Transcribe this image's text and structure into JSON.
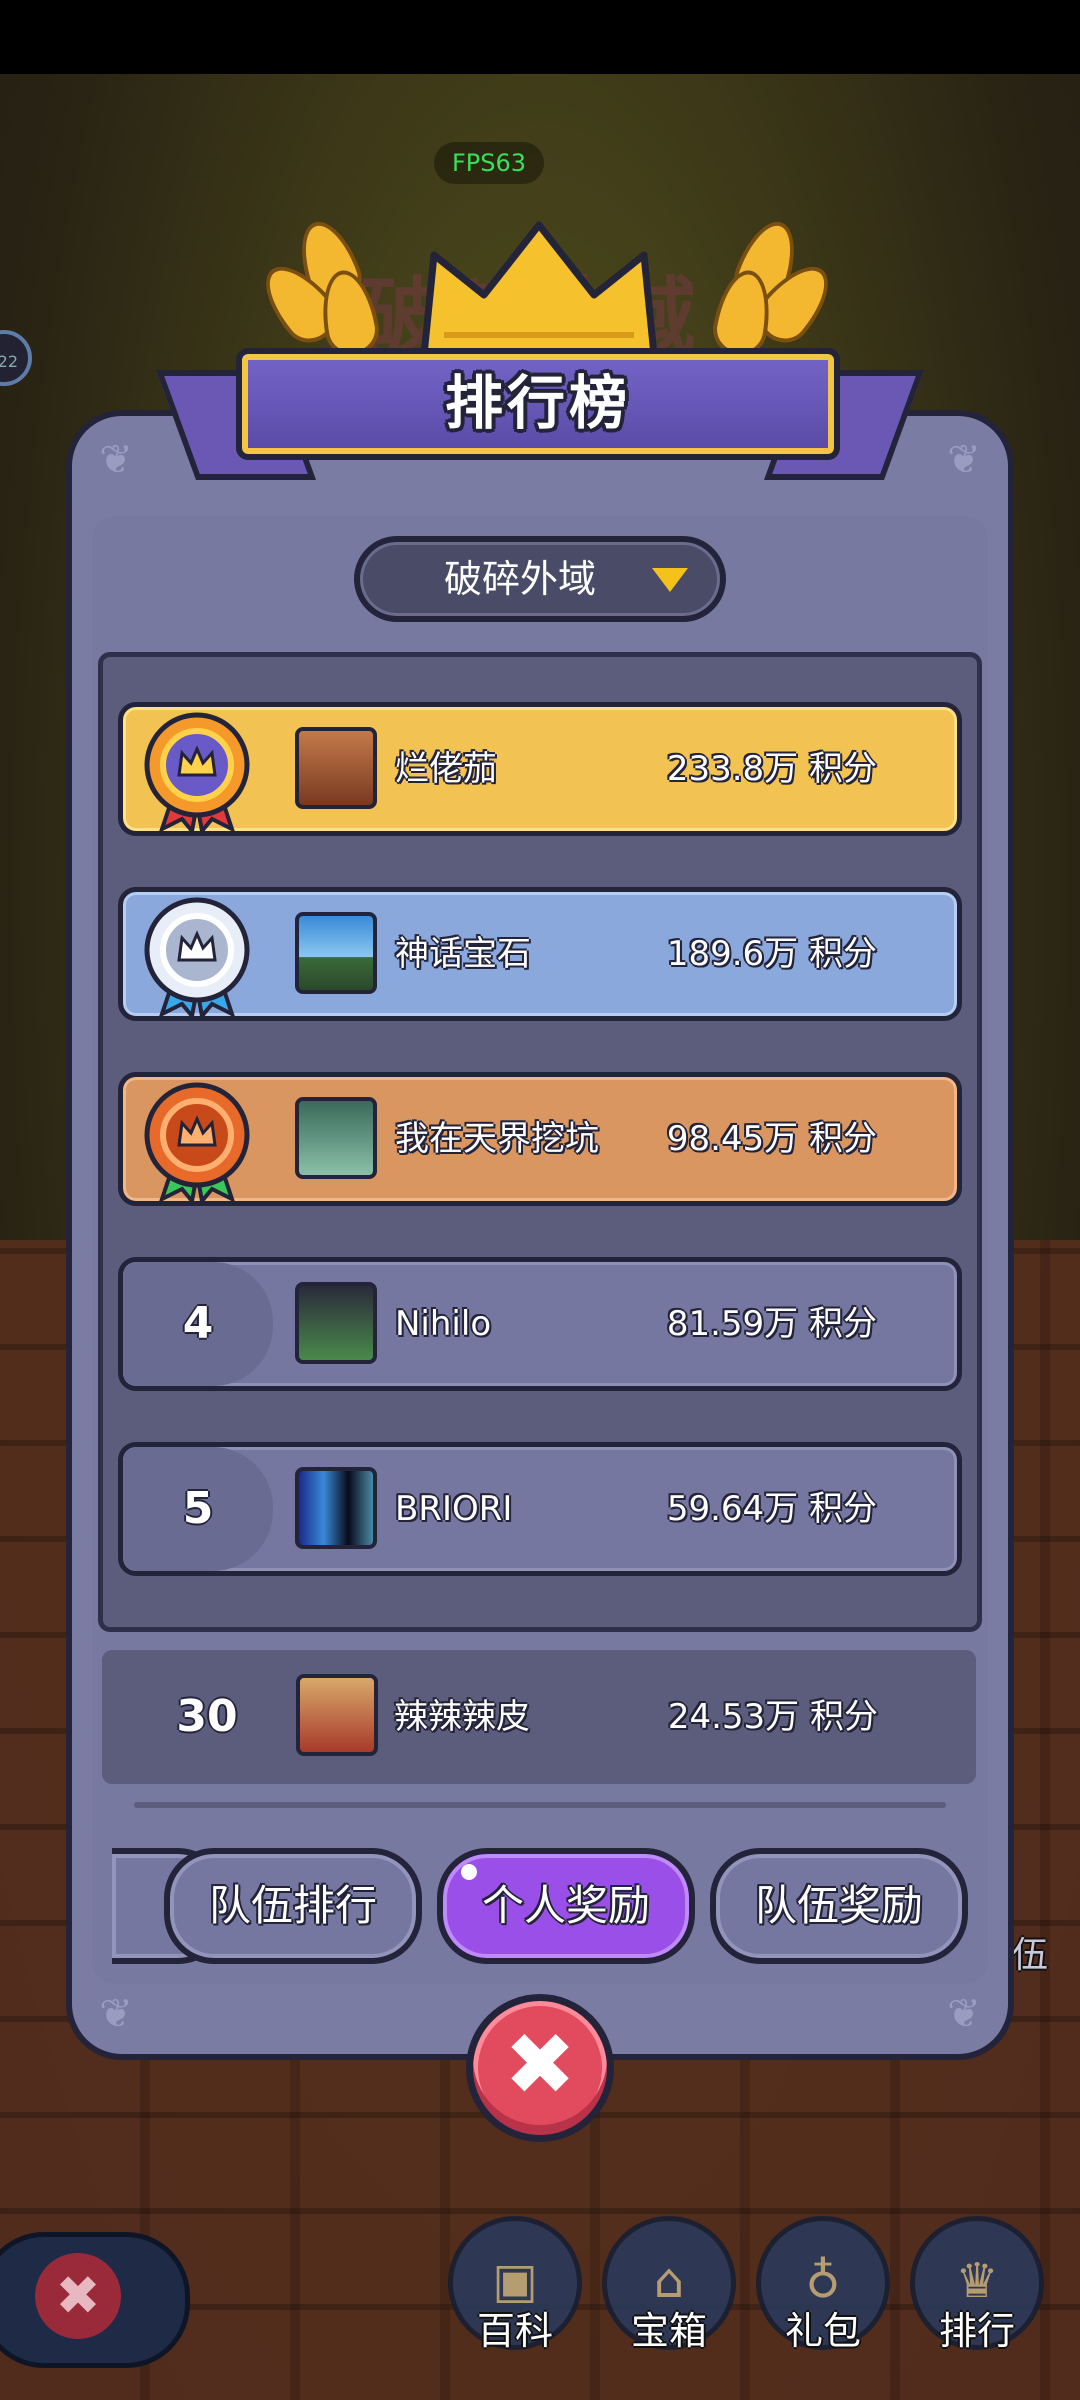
{
  "fps": "FPS63",
  "background": {
    "title": "破碎外域",
    "side_text": "伍",
    "badge": "22"
  },
  "panel": {
    "title": "排行榜",
    "dropdown": {
      "selected": "破碎外域"
    }
  },
  "rankings": [
    {
      "rank": "1",
      "medal": "gold-medal",
      "name": "烂佬茄",
      "score": "233.8万 积分",
      "row_color": "#f2c352"
    },
    {
      "rank": "2",
      "medal": "silver-medal",
      "name": "神话宝石",
      "score": "189.6万 积分",
      "row_color": "#8aa8db"
    },
    {
      "rank": "3",
      "medal": "bronze-medal",
      "name": "我在天界挖坑",
      "score": "98.45万 积分",
      "row_color": "#d99660"
    },
    {
      "rank": "4",
      "name": "Nihilo",
      "score": "81.59万 积分"
    },
    {
      "rank": "5",
      "name": "BRIORI",
      "score": "59.64万 积分"
    }
  ],
  "self": {
    "rank": "30",
    "name": "辣辣辣皮",
    "score": "24.53万 积分"
  },
  "tabs": [
    {
      "label": "",
      "active": false
    },
    {
      "label": "队伍排行",
      "active": false
    },
    {
      "label": "个人奖励",
      "active": true
    },
    {
      "label": "队伍奖励",
      "active": false
    }
  ],
  "hud": [
    {
      "label": "百科",
      "icon": "book-icon"
    },
    {
      "label": "宝箱",
      "icon": "chest-icon"
    },
    {
      "label": "礼包",
      "icon": "gift-bag-icon"
    },
    {
      "label": "排行",
      "icon": "trophy-icon"
    }
  ],
  "colors": {
    "accent": "#9a4fe8",
    "close": "#e24a5e",
    "banner": "#6a58b4",
    "gold": "#f2c352"
  }
}
